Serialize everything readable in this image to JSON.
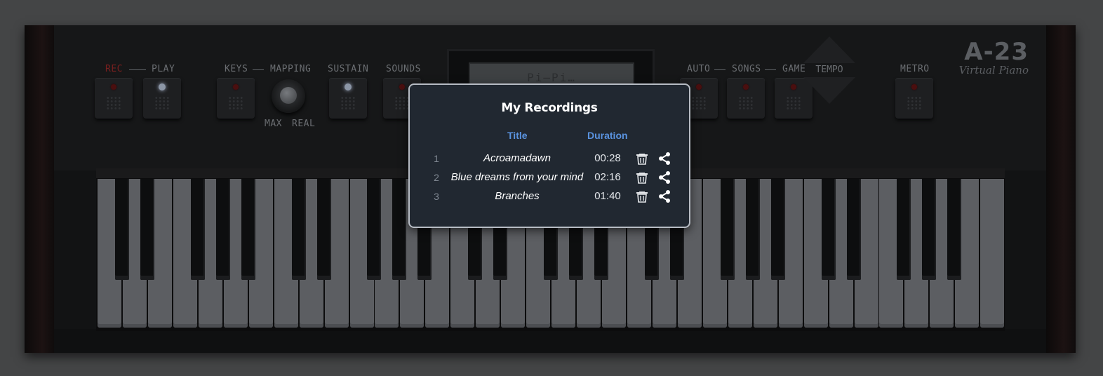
{
  "brand": {
    "model": "A-23",
    "subtitle": "Virtual Piano"
  },
  "controls": {
    "rec_label": "REC",
    "play_label": "PLAY",
    "keys_label": "KEYS",
    "mapping_label": "MAPPING",
    "knob_max_label": "MAX",
    "knob_real_label": "REAL",
    "sustain_label": "SUSTAIN",
    "sounds_label": "SOUNDS",
    "auto_label": "AUTO",
    "songs_label": "SONGS",
    "game_label": "GAME",
    "tempo_label": "TEMPO",
    "metro_label": "METRO",
    "rec_color": "#7a1f1f"
  },
  "display": {
    "text": "Pi–Pi…"
  },
  "modal": {
    "title": "My Recordings",
    "columns": {
      "title": "Title",
      "duration": "Duration"
    },
    "accent": "#5a93e0",
    "recordings": [
      {
        "index": "1",
        "title": "Acroamadawn",
        "duration": "00:28",
        "delete_icon": "trash-icon",
        "share_icon": "share-icon"
      },
      {
        "index": "2",
        "title": "Blue dreams from your mind",
        "duration": "02:16",
        "delete_icon": "trash-icon",
        "share_icon": "share-icon"
      },
      {
        "index": "3",
        "title": "Branches",
        "duration": "01:40",
        "delete_icon": "trash-icon",
        "share_icon": "share-icon"
      }
    ]
  }
}
